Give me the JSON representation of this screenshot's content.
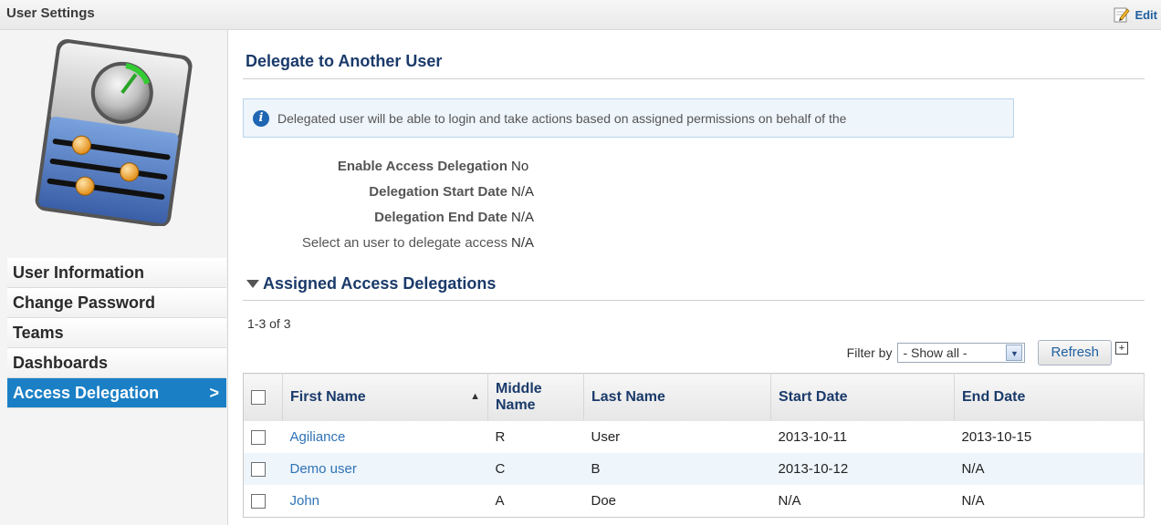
{
  "header": {
    "title": "User Settings",
    "edit_label": "Edit"
  },
  "sidebar": {
    "items": [
      {
        "label": "User Information",
        "active": false
      },
      {
        "label": "Change Password",
        "active": false
      },
      {
        "label": "Teams",
        "active": false
      },
      {
        "label": "Dashboards",
        "active": false
      },
      {
        "label": "Access Delegation",
        "active": true
      }
    ],
    "active_chevron": ">"
  },
  "main": {
    "title": "Delegate to Another User",
    "info": "Delegated user will be able to login and take actions based on assigned permissions on behalf of the",
    "fields": [
      {
        "label": "Enable Access Delegation",
        "value": "No"
      },
      {
        "label": "Delegation Start Date",
        "value": "N/A"
      },
      {
        "label": "Delegation End Date",
        "value": "N/A"
      },
      {
        "label": "Select an user to delegate access",
        "value": "N/A"
      }
    ],
    "assigned_title": "Assigned Access Delegations",
    "count": "1-3 of 3",
    "filter_label": "Filter by",
    "filter_selected": "- Show all -",
    "refresh_label": "Refresh",
    "columns": [
      "First Name",
      "Middle Name",
      "Last Name",
      "Start Date",
      "End Date"
    ],
    "rows": [
      {
        "first": "Agiliance",
        "middle": "R",
        "last": "User",
        "start": "2013-10-11",
        "end": "2013-10-15"
      },
      {
        "first": "Demo user",
        "middle": "C",
        "last": "B",
        "start": "2013-10-12",
        "end": "N/A"
      },
      {
        "first": "John",
        "middle": "A",
        "last": "Doe",
        "start": "N/A",
        "end": "N/A"
      }
    ]
  },
  "colors": {
    "accent": "#1a7fc5",
    "link": "#2f73b6",
    "heading": "#1a3a6a"
  },
  "icons": [
    "edit-icon",
    "settings-dial-icon",
    "info-icon",
    "collapse-triangle-icon",
    "sort-ascending-icon",
    "dropdown-arrow-icon",
    "expand-icon"
  ]
}
